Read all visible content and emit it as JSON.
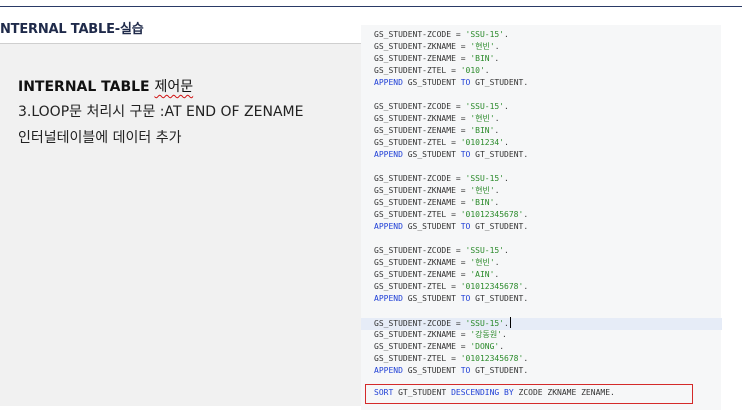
{
  "slide": {
    "title": "NTERNAL TABLE-실습",
    "heading_main": "INTERNAL TABLE ",
    "heading_squiggle": "제어문",
    "line1": "3.LOOP문 처리시 구문 :AT END OF ZENAME",
    "line2": "인터널테이블에 데이터 추가"
  },
  "code": {
    "lines": [
      [
        "GS_STUDENT-ZCODE = ",
        "'SSU-15'",
        "."
      ],
      [
        "GS_STUDENT-ZKNAME = ",
        "'현빈'",
        "."
      ],
      [
        "GS_STUDENT-ZENAME = ",
        "'BIN'",
        "."
      ],
      [
        "GS_STUDENT-ZTEL = ",
        "'010'",
        "."
      ],
      [
        "APPEND",
        " GS_STUDENT ",
        "TO",
        " GT_STUDENT."
      ],
      [
        "GS_STUDENT-ZCODE = ",
        "'SSU-15'",
        "."
      ],
      [
        "GS_STUDENT-ZKNAME = ",
        "'현빈'",
        "."
      ],
      [
        "GS_STUDENT-ZENAME = ",
        "'BIN'",
        "."
      ],
      [
        "GS_STUDENT-ZTEL = ",
        "'0101234'",
        "."
      ],
      [
        "APPEND",
        " GS_STUDENT ",
        "TO",
        " GT_STUDENT."
      ],
      [
        "GS_STUDENT-ZCODE = ",
        "'SSU-15'",
        "."
      ],
      [
        "GS_STUDENT-ZKNAME = ",
        "'현빈'",
        "."
      ],
      [
        "GS_STUDENT-ZENAME = ",
        "'BIN'",
        "."
      ],
      [
        "GS_STUDENT-ZTEL = ",
        "'01012345678'",
        "."
      ],
      [
        "APPEND",
        " GS_STUDENT ",
        "TO",
        " GT_STUDENT."
      ],
      [
        "GS_STUDENT-ZCODE = ",
        "'SSU-15'",
        "."
      ],
      [
        "GS_STUDENT-ZKNAME = ",
        "'현빈'",
        "."
      ],
      [
        "GS_STUDENT-ZENAME = ",
        "'AIN'",
        "."
      ],
      [
        "GS_STUDENT-ZTEL = ",
        "'01012345678'",
        "."
      ],
      [
        "APPEND",
        " GS_STUDENT ",
        "TO",
        " GT_STUDENT."
      ],
      [
        "GS_STUDENT-ZCODE = ",
        "'SSU-15'",
        "."
      ],
      [
        "GS_STUDENT-ZKNAME = ",
        "'강동원'",
        "."
      ],
      [
        "GS_STUDENT-ZENAME = ",
        "'DONG'",
        "."
      ],
      [
        "GS_STUDENT-ZTEL = ",
        "'01012345678'",
        "."
      ],
      [
        "APPEND",
        " GS_STUDENT ",
        "TO",
        " GT_STUDENT."
      ]
    ],
    "sort": {
      "kw1": "SORT",
      "t1": " GT_STUDENT ",
      "kw2": "DESCENDING BY",
      "t2": " ZCODE ZKNAME ZENAME."
    }
  },
  "colors": {
    "keyword": "#1f3fd6",
    "string": "#2a8a2a",
    "highlight_box": "#d42a2a"
  }
}
